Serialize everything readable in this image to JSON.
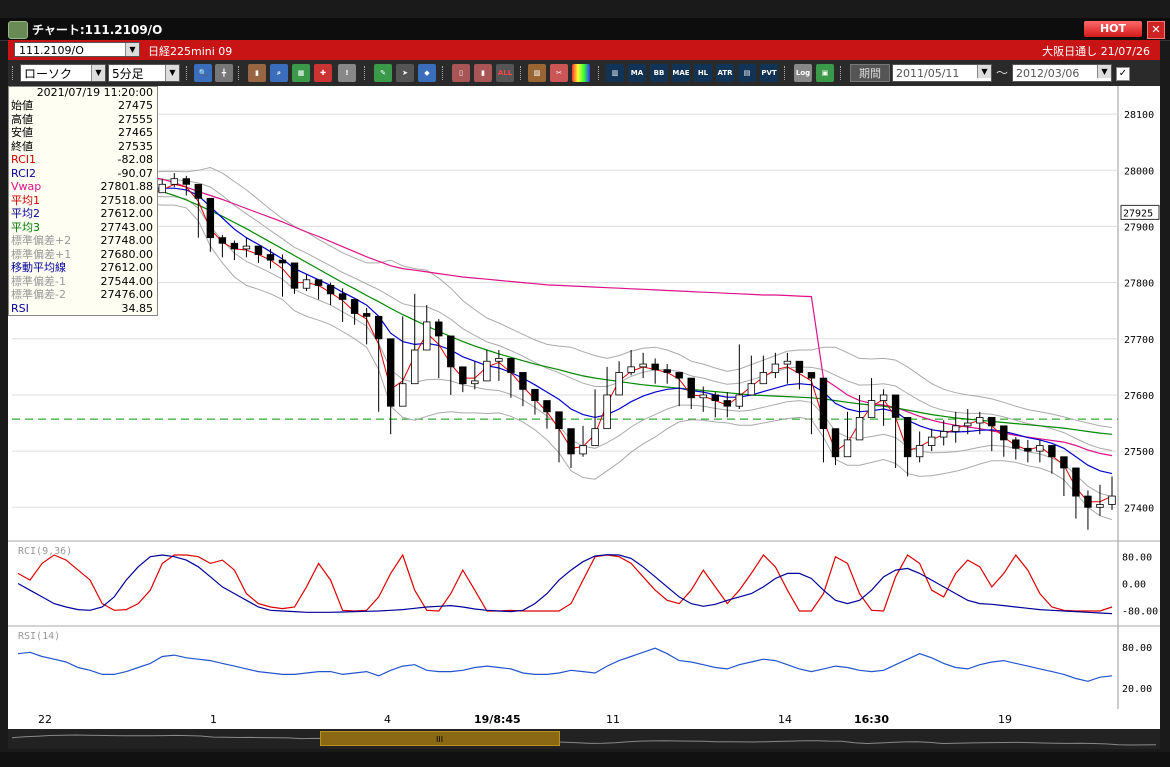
{
  "window": {
    "title": "チャート:111.2109/O",
    "hot_label": "HOT",
    "close_label": "✕"
  },
  "symbol_bar": {
    "code": "111.2109/O",
    "name": "日経225mini 09",
    "right_info": "大阪日通し 21/07/26"
  },
  "toolbar": {
    "chart_type": "ローソク",
    "interval": "5分足",
    "period_label": "期間",
    "date_from": "2011/05/11",
    "date_to": "2012/03/06",
    "tilde": "～",
    "check": "✓",
    "btn_all": "ALL",
    "btn_ma": "MA",
    "btn_bb": "BB",
    "btn_mae": "MAE",
    "btn_hl": "HL",
    "btn_atr": "ATR",
    "btn_pvt": "PVT",
    "btn_log": "Log"
  },
  "info_panel": {
    "datetime": "2021/07/19 11:20:00",
    "rows": [
      {
        "label": "始値",
        "value": "27475",
        "color": "#000000"
      },
      {
        "label": "高値",
        "value": "27555",
        "color": "#000000"
      },
      {
        "label": "安値",
        "value": "27465",
        "color": "#000000"
      },
      {
        "label": "終値",
        "value": "27535",
        "color": "#000000"
      },
      {
        "label": "RCI1",
        "value": "-82.08",
        "color": "#cc0000"
      },
      {
        "label": "RCI2",
        "value": "-90.07",
        "color": "#000099"
      },
      {
        "label": "Vwap",
        "value": "27801.88",
        "color": "#dd1188"
      },
      {
        "label": "平均1",
        "value": "27518.00",
        "color": "#cc0000"
      },
      {
        "label": "平均2",
        "value": "27612.00",
        "color": "#000099"
      },
      {
        "label": "平均3",
        "value": "27743.00",
        "color": "#007700"
      },
      {
        "label": "標準偏差+2",
        "value": "27748.00",
        "color": "#999999"
      },
      {
        "label": "標準偏差+1",
        "value": "27680.00",
        "color": "#999999"
      },
      {
        "label": "移動平均線",
        "value": "27612.00",
        "color": "#000099"
      },
      {
        "label": "標準偏差-1",
        "value": "27544.00",
        "color": "#999999"
      },
      {
        "label": "標準偏差-2",
        "value": "27476.00",
        "color": "#999999"
      },
      {
        "label": "RSI",
        "value": "34.85",
        "color": "#000099"
      }
    ]
  },
  "chart_data": {
    "type": "candlestick",
    "price_axis": {
      "ticks": [
        "28100",
        "28000",
        "27900",
        "27800",
        "27700",
        "27600",
        "27500",
        "27400"
      ],
      "ylim": [
        27340,
        28150
      ],
      "current_price": "27925"
    },
    "x_axis_labels": [
      "22",
      "1",
      "4",
      "19/8:45",
      "11",
      "14",
      "16:30",
      "19"
    ],
    "subpanels": [
      {
        "name": "RCI(9,36)",
        "ticks": [
          "80.00",
          "0.00",
          "-80.00"
        ],
        "series": [
          "RCI1",
          "RCI2"
        ]
      },
      {
        "name": "RSI(14)",
        "ticks": [
          "80.00",
          "20.00"
        ],
        "series": [
          "RSI"
        ]
      }
    ],
    "colors": {
      "ma_short": "#dd0000",
      "ma_mid": "#0000cc",
      "ma_long": "#008800",
      "vwap": "#dd1188",
      "bands": "#aaaaaa",
      "dashed_level": "#009900",
      "rci1": "#dd0000",
      "rci2": "#000099",
      "rsi": "#2255cc"
    },
    "dashed_level_price": 27557,
    "closes": [
      27845,
      27900,
      27935,
      27980,
      28000,
      28010,
      27990,
      27985,
      27975,
      27970,
      27965,
      27960,
      27975,
      27985,
      27975,
      27950,
      27880,
      27870,
      27860,
      27865,
      27850,
      27840,
      27835,
      27790,
      27805,
      27795,
      27780,
      27770,
      27745,
      27740,
      27700,
      27580,
      27620,
      27680,
      27730,
      27705,
      27650,
      27620,
      27625,
      27660,
      27665,
      27640,
      27610,
      27590,
      27570,
      27540,
      27495,
      27510,
      27540,
      27600,
      27640,
      27650,
      27655,
      27645,
      27640,
      27630,
      27595,
      27600,
      27590,
      27580,
      27600,
      27620,
      27640,
      27655,
      27660,
      27640,
      27630,
      27540,
      27490,
      27520,
      27560,
      27590,
      27600,
      27560,
      27490,
      27510,
      27525,
      27535,
      27545,
      27550,
      27560,
      27545,
      27520,
      27505,
      27500,
      27510,
      27490,
      27470,
      27420,
      27400,
      27405,
      27420
    ],
    "highs": [
      27880,
      27930,
      27960,
      28000,
      28020,
      28015,
      28000,
      27995,
      27985,
      27980,
      27975,
      27970,
      27985,
      27995,
      27990,
      27975,
      27905,
      27885,
      27875,
      27880,
      27865,
      27860,
      27850,
      27820,
      27815,
      27805,
      27800,
      27790,
      27770,
      27755,
      27735,
      27660,
      27740,
      27780,
      27760,
      27735,
      27680,
      27640,
      27660,
      27680,
      27680,
      27665,
      27640,
      27610,
      27590,
      27560,
      27525,
      27545,
      27610,
      27650,
      27660,
      27680,
      27675,
      27665,
      27655,
      27640,
      27620,
      27615,
      27605,
      27605,
      27690,
      27670,
      27670,
      27675,
      27675,
      27660,
      27640,
      27600,
      27530,
      27570,
      27600,
      27630,
      27610,
      27600,
      27525,
      27535,
      27540,
      27555,
      27570,
      27575,
      27570,
      27560,
      27540,
      27525,
      27520,
      27520,
      27505,
      27490,
      27460,
      27430,
      27440,
      27455
    ],
    "lows": [
      27820,
      27880,
      27915,
      27960,
      27985,
      27985,
      27975,
      27965,
      27960,
      27955,
      27955,
      27950,
      27965,
      27970,
      27955,
      27880,
      27855,
      27845,
      27840,
      27845,
      27835,
      27825,
      27775,
      27780,
      27785,
      27770,
      27760,
      27730,
      27725,
      27690,
      27570,
      27530,
      27580,
      27650,
      27680,
      27630,
      27600,
      27605,
      27610,
      27630,
      27625,
      27595,
      27580,
      27565,
      27540,
      27480,
      27470,
      27490,
      27520,
      27590,
      27620,
      27635,
      27630,
      27620,
      27620,
      27580,
      27575,
      27570,
      27560,
      27560,
      27575,
      27605,
      27620,
      27630,
      27620,
      27610,
      27530,
      27480,
      27475,
      27495,
      27540,
      27560,
      27545,
      27470,
      27455,
      27480,
      27500,
      27510,
      27515,
      27530,
      27530,
      27500,
      27490,
      27485,
      27480,
      27480,
      27460,
      27420,
      27380,
      27360,
      27385,
      27395
    ],
    "ma_short": [
      27835,
      27880,
      27920,
      27960,
      27985,
      27998,
      27990,
      27982,
      27975,
      27968,
      27962,
      27958,
      27965,
      27975,
      27970,
      27945,
      27895,
      27872,
      27860,
      27858,
      27850,
      27840,
      27825,
      27800,
      27800,
      27795,
      27782,
      27768,
      27748,
      27735,
      27690,
      27610,
      27625,
      27670,
      27710,
      27690,
      27655,
      27630,
      27630,
      27650,
      27658,
      27640,
      27615,
      27592,
      27570,
      27540,
      27505,
      27508,
      27530,
      27585,
      27625,
      27642,
      27650,
      27645,
      27640,
      27628,
      27600,
      27598,
      27590,
      27582,
      27598,
      27615,
      27632,
      27645,
      27650,
      27638,
      27625,
      27555,
      27500,
      27515,
      27550,
      27580,
      27592,
      27560,
      27500,
      27508,
      27520,
      27530,
      27540,
      27548,
      27555,
      27545,
      27525,
      27510,
      27502,
      27508,
      27492,
      27475,
      27435,
      27410,
      27410,
      27420
    ],
    "ma_mid": [
      27880,
      27900,
      27915,
      27935,
      27950,
      27962,
      27968,
      27970,
      27972,
      27972,
      27970,
      27968,
      27968,
      27968,
      27965,
      27955,
      27935,
      27915,
      27895,
      27880,
      27868,
      27855,
      27842,
      27825,
      27815,
      27805,
      27795,
      27783,
      27772,
      27760,
      27740,
      27710,
      27695,
      27690,
      27692,
      27688,
      27680,
      27668,
      27660,
      27652,
      27648,
      27640,
      27630,
      27618,
      27605,
      27592,
      27575,
      27565,
      27560,
      27565,
      27575,
      27588,
      27598,
      27605,
      27610,
      27612,
      27608,
      27605,
      27600,
      27596,
      27596,
      27600,
      27606,
      27612,
      27618,
      27620,
      27618,
      27605,
      27585,
      27575,
      27570,
      27572,
      27575,
      27570,
      27555,
      27545,
      27538,
      27535,
      27534,
      27535,
      27537,
      27538,
      27535,
      27530,
      27524,
      27520,
      27514,
      27505,
      27490,
      27475,
      27465,
      27460
    ],
    "ma_long": [
      27960,
      27975,
      27985,
      27992,
      27995,
      27996,
      27995,
      27992,
      27988,
      27983,
      27977,
      27970,
      27962,
      27955,
      27947,
      27938,
      27928,
      27918,
      27907,
      27896,
      27884,
      27872,
      27860,
      27848,
      27836,
      27824,
      27812,
      27800,
      27789,
      27777,
      27766,
      27754,
      27743,
      27733,
      27723,
      27713,
      27704,
      27695,
      27687,
      27680,
      27673,
      27667,
      27661,
      27655,
      27650,
      27645,
      27639,
      27634,
      27630,
      27627,
      27624,
      27621,
      27618,
      27616,
      27614,
      27612,
      27610,
      27608,
      27606,
      27604,
      27602,
      27600,
      27599,
      27598,
      27597,
      27596,
      27595,
      27593,
      27590,
      27587,
      27584,
      27582,
      27580,
      27577,
      27573,
      27569,
      27565,
      27562,
      27559,
      27557,
      27555,
      27553,
      27551,
      27549,
      27547,
      27545,
      27543,
      27541,
      27538,
      27535,
      27532,
      27530
    ],
    "vwap": [
      27975,
      27980,
      27985,
      27990,
      27993,
      27995,
      27995,
      27995,
      27994,
      27993,
      27991,
      27988,
      27984,
      27978,
      27970,
      27962,
      27955,
      27948,
      27940,
      27932,
      27924,
      27916,
      27908,
      27899,
      27890,
      27882,
      27873,
      27864,
      27855,
      27846,
      27838,
      27830,
      27825,
      27822,
      27819,
      27816,
      27813,
      27810,
      27808,
      27806,
      27804,
      27802,
      27800,
      27798,
      27796,
      27795,
      27794,
      27793,
      27792,
      27791,
      27790,
      27789,
      27788,
      27787,
      27786,
      27785,
      27784,
      27783,
      27782,
      27781,
      27780,
      27779,
      27778,
      27778,
      27777,
      27776,
      27775,
      27629,
      27615,
      27600,
      27590,
      27585,
      27582,
      27578,
      27570,
      27562,
      27555,
      27550,
      27546,
      27543,
      27540,
      27536,
      27532,
      27528,
      27525,
      27522,
      27519,
      27516,
      27510,
      27502,
      27496,
      27492
    ],
    "band_width": [
      90,
      90,
      85,
      80,
      70,
      55,
      40,
      30,
      28,
      28,
      28,
      28,
      30,
      30,
      32,
      45,
      70,
      80,
      85,
      85,
      80,
      75,
      72,
      75,
      75,
      72,
      70,
      70,
      72,
      75,
      95,
      130,
      135,
      135,
      130,
      120,
      110,
      100,
      92,
      85,
      80,
      78,
      78,
      80,
      85,
      95,
      110,
      112,
      110,
      100,
      95,
      90,
      85,
      80,
      70,
      60,
      52,
      50,
      48,
      46,
      50,
      54,
      56,
      58,
      60,
      60,
      62,
      80,
      100,
      100,
      95,
      92,
      90,
      92,
      95,
      90,
      82,
      75,
      70,
      65,
      60,
      55,
      52,
      50,
      50,
      50,
      52,
      56,
      65,
      75,
      80,
      82
    ],
    "rci1": [
      30,
      10,
      60,
      85,
      70,
      40,
      10,
      -60,
      -80,
      -78,
      -60,
      -20,
      60,
      85,
      85,
      80,
      60,
      70,
      40,
      -30,
      -60,
      -70,
      -75,
      -70,
      -10,
      60,
      10,
      -80,
      -82,
      -80,
      -40,
      30,
      85,
      -20,
      -80,
      -82,
      -30,
      40,
      -20,
      -82,
      -82,
      -80,
      -82,
      -82,
      -82,
      -82,
      -60,
      10,
      80,
      85,
      80,
      60,
      20,
      -20,
      -50,
      -60,
      -20,
      40,
      -10,
      -60,
      -20,
      30,
      85,
      50,
      -20,
      -82,
      -82,
      -30,
      80,
      60,
      -30,
      -80,
      -82,
      20,
      85,
      60,
      -20,
      -40,
      30,
      70,
      50,
      -10,
      30,
      85,
      40,
      -30,
      -70,
      -80,
      -82,
      -82,
      -82,
      -70
    ],
    "rci2": [
      0,
      -20,
      -40,
      -60,
      -70,
      -78,
      -80,
      -70,
      -40,
      10,
      50,
      80,
      85,
      80,
      70,
      50,
      20,
      -10,
      -30,
      -50,
      -70,
      -80,
      -82,
      -84,
      -86,
      -86,
      -86,
      -85,
      -84,
      -83,
      -82,
      -80,
      -78,
      -74,
      -70,
      -68,
      -66,
      -70,
      -76,
      -80,
      -82,
      -84,
      -80,
      -60,
      -30,
      10,
      40,
      65,
      82,
      86,
      85,
      75,
      50,
      20,
      -10,
      -40,
      -60,
      -68,
      -62,
      -50,
      -40,
      -30,
      -10,
      15,
      30,
      30,
      15,
      -20,
      -50,
      -60,
      -50,
      -20,
      20,
      40,
      45,
      30,
      10,
      -10,
      -30,
      -50,
      -60,
      -62,
      -66,
      -70,
      -74,
      -78,
      -80,
      -82,
      -84,
      -86,
      -88,
      -90
    ],
    "rsi": [
      70,
      72,
      66,
      62,
      58,
      50,
      46,
      40,
      40,
      44,
      50,
      56,
      66,
      68,
      64,
      62,
      60,
      56,
      52,
      48,
      44,
      42,
      40,
      40,
      42,
      44,
      44,
      40,
      42,
      44,
      38,
      46,
      52,
      54,
      46,
      44,
      44,
      46,
      50,
      52,
      50,
      48,
      42,
      40,
      40,
      42,
      46,
      44,
      42,
      52,
      60,
      66,
      72,
      78,
      70,
      60,
      58,
      54,
      50,
      48,
      54,
      58,
      62,
      60,
      54,
      48,
      44,
      48,
      52,
      50,
      46,
      44,
      46,
      54,
      62,
      70,
      64,
      56,
      50,
      48,
      54,
      58,
      60,
      56,
      52,
      48,
      44,
      40,
      34,
      30,
      36,
      38
    ]
  }
}
